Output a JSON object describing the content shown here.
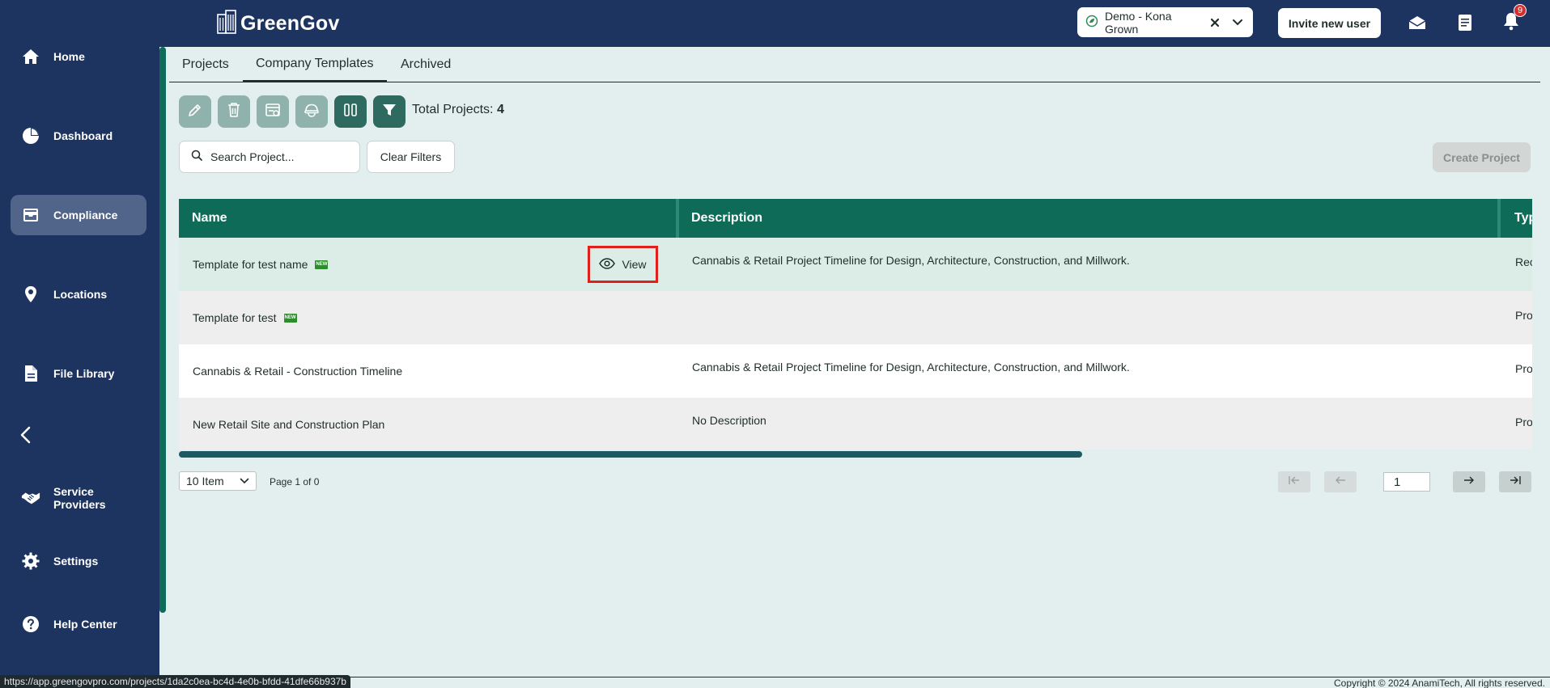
{
  "app": {
    "name": "GreenGov"
  },
  "sidebar": {
    "items": [
      {
        "label": "Home",
        "icon": "home-icon"
      },
      {
        "label": "Dashboard",
        "icon": "pie-chart-icon"
      },
      {
        "label": "Compliance",
        "icon": "inbox-icon",
        "active": true
      },
      {
        "label": "Locations",
        "icon": "location-pin-icon"
      },
      {
        "label": "File Library",
        "icon": "file-icon"
      },
      {
        "label": "Service Providers",
        "icon": "handshake-icon"
      },
      {
        "label": "Settings",
        "icon": "gear-icon"
      },
      {
        "label": "Help Center",
        "icon": "help-icon"
      }
    ]
  },
  "header": {
    "org_select_value": "Demo - Kona Grown",
    "invite_label": "Invite new user",
    "notification_count": "9"
  },
  "tabs": [
    {
      "label": "Projects"
    },
    {
      "label": "Company Templates",
      "active": true
    },
    {
      "label": "Archived"
    }
  ],
  "toolbar": {
    "total_label": "Total Projects:",
    "total_value": "4"
  },
  "search": {
    "placeholder": "Search Project..."
  },
  "clear_filters_label": "Clear Filters",
  "create_project_label": "Create Project",
  "table": {
    "columns": [
      "Name",
      "Description",
      "Typ"
    ],
    "view_label": "View",
    "rows": [
      {
        "name": "Template for test name",
        "new": "NEW",
        "description": "Cannabis & Retail Project Timeline for Design, Architecture, Construction, and Millwork.",
        "type": "Rec"
      },
      {
        "name": "Template for test",
        "new": "NEW",
        "description": "",
        "type": "Pro"
      },
      {
        "name": "Cannabis & Retail - Construction Timeline",
        "description": "Cannabis & Retail Project Timeline for Design, Architecture, Construction, and Millwork.",
        "type": "Pro"
      },
      {
        "name": "New Retail Site and Construction Plan",
        "description": "No Description",
        "type": "Pro"
      }
    ]
  },
  "pagination": {
    "per_page": "10 Item",
    "page_info": "Page 1 of 0",
    "current_page": "1"
  },
  "status_url": "https://app.greengovpro.com/projects/1da2c0ea-bc4d-4e0b-bfdd-41dfe66b937b",
  "copyright": "Copyright © 2024 AnamiTech, All rights reserved."
}
